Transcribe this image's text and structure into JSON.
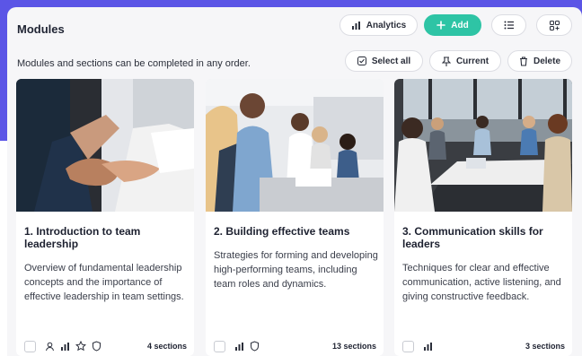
{
  "header": {
    "title": "Modules",
    "analytics_label": "Analytics",
    "add_label": "Add"
  },
  "toolbar": {
    "subtitle": "Modules and sections can be completed in any order.",
    "select_all_label": "Select all",
    "current_label": "Current",
    "delete_label": "Delete"
  },
  "modules": [
    {
      "title": "1. Introduction to team leadership",
      "description": "Overview of fundamental leadership concepts and the importance of effective leadership in team settings.",
      "sections": "4 sections",
      "icons": [
        "user-icon",
        "bar-chart-icon",
        "star-icon",
        "shield-icon"
      ]
    },
    {
      "title": "2. Building effective teams",
      "description": "Strategies for forming and developing high-performing teams, including team roles and dynamics.",
      "sections": "13 sections",
      "icons": [
        "bar-chart-icon",
        "shield-icon"
      ]
    },
    {
      "title": "3. Communication skills for leaders",
      "description": "Techniques for clear and effective communication, active listening, and giving constructive feedback.",
      "sections": "3 sections",
      "icons": [
        "bar-chart-icon"
      ]
    }
  ],
  "colors": {
    "background_accent": "#5b55e6",
    "add_button": "#2ec4a5"
  }
}
